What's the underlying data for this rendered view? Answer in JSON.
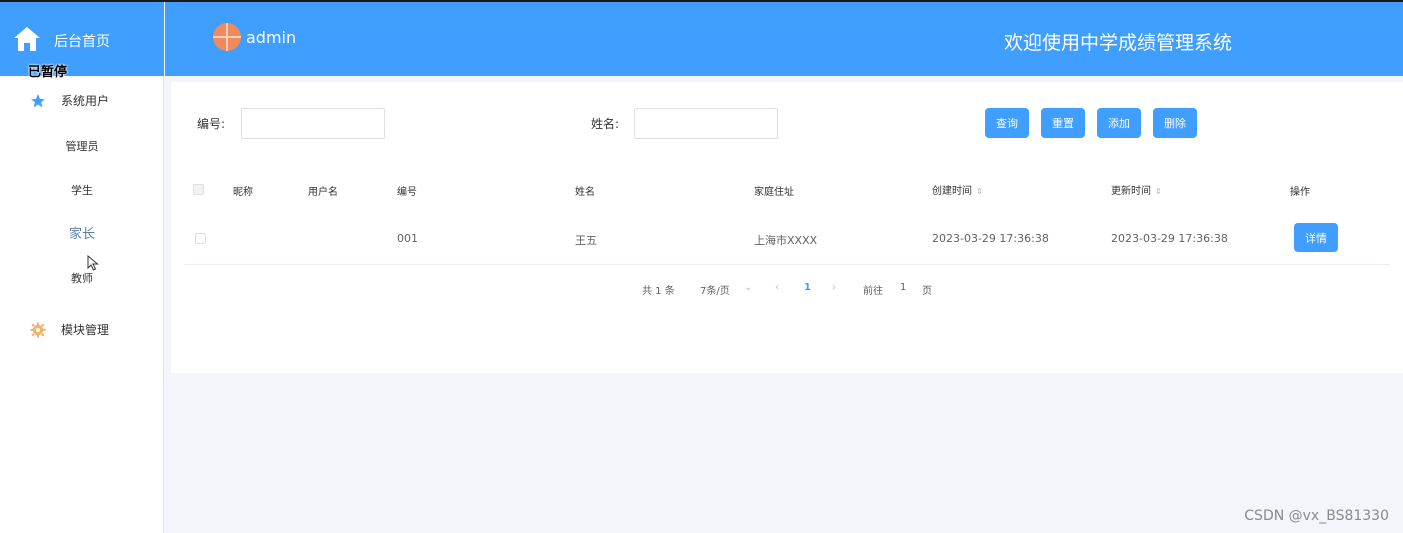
{
  "sidebar": {
    "home_label": "后台首页",
    "paused_label": "已暂停",
    "groups": [
      {
        "label": "系统用户",
        "icon": "star-icon",
        "items": [
          "管理员",
          "学生",
          "家长",
          "教师"
        ]
      },
      {
        "label": "模块管理",
        "icon": "gear-icon"
      }
    ],
    "active_item": "家长"
  },
  "header": {
    "username": "admin",
    "title": "欢迎使用中学成绩管理系统"
  },
  "search": {
    "id_label": "编号:",
    "id_value": "",
    "name_label": "姓名:",
    "name_value": ""
  },
  "buttons": {
    "query": "查询",
    "reset": "重置",
    "add": "添加",
    "delete": "删除"
  },
  "table": {
    "columns": [
      "昵称",
      "用户名",
      "编号",
      "姓名",
      "家庭住址",
      "创建时间",
      "更新时间",
      "操作"
    ],
    "rows": [
      {
        "nickname": "",
        "username": "",
        "id": "001",
        "name": "王五",
        "address": "上海市XXXX",
        "created": "2023-03-29 17:36:38",
        "updated": "2023-03-29 17:36:38",
        "action": "详情"
      }
    ]
  },
  "pagination": {
    "total": "共 1 条",
    "page_size": "7条/页",
    "current_page": "1",
    "goto_prefix": "前往",
    "goto_value": "1",
    "goto_suffix": "页"
  },
  "watermark": "CSDN @vx_BS81330",
  "colors": {
    "primary": "#409eff",
    "background": "#f4f5fa"
  }
}
